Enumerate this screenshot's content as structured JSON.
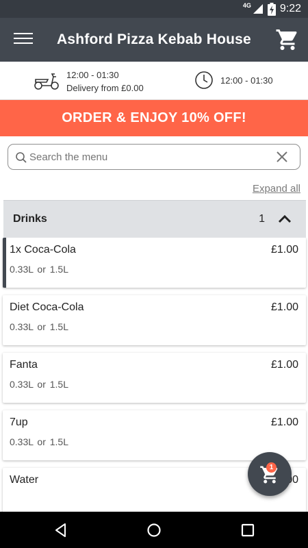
{
  "status_bar": {
    "network": "4G",
    "time": "9:22",
    "icons": [
      "signal-icon",
      "battery-charging-icon"
    ]
  },
  "app_bar": {
    "title": "Ashford Pizza Kebab House",
    "icons": [
      "menu-icon",
      "cart-icon"
    ]
  },
  "info": {
    "delivery_hours": "12:00 - 01:30",
    "delivery_fee": "Delivery from £0.00",
    "opening_hours": "12:00 - 01:30",
    "icons": [
      "scooter-icon",
      "clock-icon"
    ]
  },
  "promo": {
    "text": "ORDER & ENJOY 10% OFF!",
    "color": "#ff6548"
  },
  "search": {
    "placeholder": "Search the menu",
    "value": ""
  },
  "expand_all_label": "Expand all",
  "category": {
    "name": "Drinks",
    "count": "1"
  },
  "items": [
    {
      "qty": "1x",
      "name": "Coca-Cola",
      "price": "£1.00",
      "options": "0.33L or  1.5L"
    },
    {
      "qty": "",
      "name": "Diet Coca-Cola",
      "price": "£1.00",
      "options": "0.33L or  1.5L"
    },
    {
      "qty": "",
      "name": "Fanta",
      "price": "£1.00",
      "options": "0.33L or  1.5L"
    },
    {
      "qty": "",
      "name": "7up",
      "price": "£1.00",
      "options": "0.33L or  1.5L"
    },
    {
      "qty": "",
      "name": "Water",
      "price": "£1.00",
      "options": ""
    }
  ],
  "cart_fab": {
    "badge": "1"
  },
  "colors": {
    "header": "#424850",
    "accent": "#ff6548",
    "category_bg": "#dfe1e4"
  }
}
